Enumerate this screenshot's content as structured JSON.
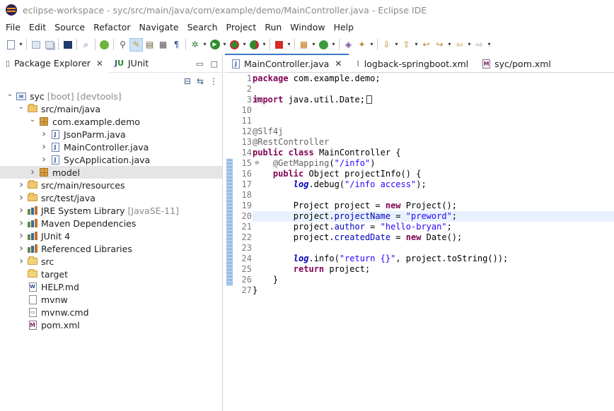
{
  "window": {
    "title": "eclipse-workspace - syc/src/main/java/com/example/demo/MainController.java - Eclipse IDE"
  },
  "menu": [
    "File",
    "Edit",
    "Source",
    "Refactor",
    "Navigate",
    "Search",
    "Project",
    "Run",
    "Window",
    "Help"
  ],
  "toolbar": {
    "icons": [
      "new-icon",
      "save-icon",
      "save-all-icon",
      "terminal-icon",
      "search-task-icon",
      "spring-boot-icon",
      "open-type-icon",
      "mark-occurrences-icon",
      "open-task-icon",
      "annotations-icon",
      "show-whitespace-icon",
      "debug-icon",
      "run-icon",
      "coverage-icon",
      "external-tools-icon",
      "stop-icon",
      "new-java-package-icon",
      "new-class-icon",
      "open-perspective-icon",
      "next-annotation-icon",
      "prev-annotation-icon",
      "last-edit-icon",
      "back-icon",
      "forward-icon"
    ]
  },
  "left_panel": {
    "tabs": [
      {
        "label": "Package Explorer",
        "active": true,
        "closable": true
      },
      {
        "label": "JUnit",
        "active": false,
        "closable": false
      }
    ],
    "tree": [
      {
        "label": "syc",
        "decoration": "[boot] [devtools]",
        "level": 0,
        "expanded": true,
        "icon": "project-icon"
      },
      {
        "label": "src/main/java",
        "level": 1,
        "expanded": true,
        "icon": "source-folder-icon"
      },
      {
        "label": "com.example.demo",
        "level": 2,
        "expanded": true,
        "icon": "package-icon"
      },
      {
        "label": "JsonParm.java",
        "level": 3,
        "expanded": false,
        "icon": "java-file-icon"
      },
      {
        "label": "MainController.java",
        "level": 3,
        "expanded": false,
        "icon": "java-file-icon"
      },
      {
        "label": "SycApplication.java",
        "level": 3,
        "expanded": false,
        "icon": "java-file-icon"
      },
      {
        "label": "model",
        "level": 2,
        "expanded": false,
        "icon": "package-icon",
        "selected": true
      },
      {
        "label": "src/main/resources",
        "level": 1,
        "expanded": false,
        "icon": "source-folder-icon"
      },
      {
        "label": "src/test/java",
        "level": 1,
        "expanded": false,
        "icon": "source-folder-icon"
      },
      {
        "label": "JRE System Library",
        "decoration": "[JavaSE-11]",
        "level": 1,
        "expanded": false,
        "icon": "library-icon"
      },
      {
        "label": "Maven Dependencies",
        "level": 1,
        "expanded": false,
        "icon": "library-icon"
      },
      {
        "label": "JUnit 4",
        "level": 1,
        "expanded": false,
        "icon": "library-icon"
      },
      {
        "label": "Referenced Libraries",
        "level": 1,
        "expanded": false,
        "icon": "library-icon"
      },
      {
        "label": "src",
        "level": 1,
        "expanded": false,
        "icon": "folder-icon"
      },
      {
        "label": "target",
        "level": 1,
        "expanded": null,
        "icon": "folder-icon"
      },
      {
        "label": "HELP.md",
        "level": 1,
        "expanded": null,
        "icon": "markdown-file-icon"
      },
      {
        "label": "mvnw",
        "level": 1,
        "expanded": null,
        "icon": "file-icon"
      },
      {
        "label": "mvnw.cmd",
        "level": 1,
        "expanded": null,
        "icon": "cmd-file-icon"
      },
      {
        "label": "pom.xml",
        "level": 1,
        "expanded": null,
        "icon": "maven-file-icon"
      }
    ]
  },
  "editor": {
    "tabs": [
      {
        "label": "MainController.java",
        "active": true,
        "closable": true,
        "icon": "java-file-icon"
      },
      {
        "label": "logback-springboot.xml",
        "active": false,
        "closable": false,
        "icon": "xml-file-icon"
      },
      {
        "label": "syc/pom.xml",
        "active": false,
        "closable": false,
        "icon": "maven-file-icon"
      }
    ],
    "current_line": 20,
    "lines": [
      {
        "n": "1",
        "tokens": [
          {
            "t": "package",
            "c": "kw"
          },
          {
            "t": " com.example.demo;"
          }
        ]
      },
      {
        "n": "2",
        "tokens": []
      },
      {
        "n": "3",
        "fold": "⊕",
        "tokens": [
          {
            "t": "import",
            "c": "kw"
          },
          {
            "t": " java.util.Date;"
          },
          {
            "t": "",
            "c": "mark"
          }
        ]
      },
      {
        "n": "10",
        "tokens": []
      },
      {
        "n": "11",
        "tokens": []
      },
      {
        "n": "12",
        "tokens": [
          {
            "t": "@Slf4j",
            "c": "ann"
          }
        ]
      },
      {
        "n": "13",
        "tokens": [
          {
            "t": "@RestController",
            "c": "ann"
          }
        ]
      },
      {
        "n": "14",
        "tokens": [
          {
            "t": "public",
            "c": "kw"
          },
          {
            "t": " "
          },
          {
            "t": "class",
            "c": "kw"
          },
          {
            "t": " MainController {"
          }
        ]
      },
      {
        "n": "15",
        "fold": "⊖",
        "tokens": [
          {
            "t": "    "
          },
          {
            "t": "@GetMapping",
            "c": "ann"
          },
          {
            "t": "("
          },
          {
            "t": "\"/info\"",
            "c": "str"
          },
          {
            "t": ")"
          }
        ]
      },
      {
        "n": "16",
        "tokens": [
          {
            "t": "    "
          },
          {
            "t": "public",
            "c": "kw"
          },
          {
            "t": " Object projectInfo() {"
          }
        ]
      },
      {
        "n": "17",
        "tokens": [
          {
            "t": "        "
          },
          {
            "t": "log",
            "c": "sfld"
          },
          {
            "t": ".debug("
          },
          {
            "t": "\"/info access\"",
            "c": "str"
          },
          {
            "t": ");"
          }
        ]
      },
      {
        "n": "18",
        "tokens": []
      },
      {
        "n": "19",
        "tokens": [
          {
            "t": "        Project project = "
          },
          {
            "t": "new",
            "c": "kw"
          },
          {
            "t": " Project();"
          }
        ]
      },
      {
        "n": "20",
        "tokens": [
          {
            "t": "        project."
          },
          {
            "t": "projectName",
            "c": "fld"
          },
          {
            "t": " = "
          },
          {
            "t": "\"preword\"",
            "c": "str"
          },
          {
            "t": ";"
          }
        ]
      },
      {
        "n": "21",
        "tokens": [
          {
            "t": "        project."
          },
          {
            "t": "author",
            "c": "fld"
          },
          {
            "t": " = "
          },
          {
            "t": "\"hello-bryan\"",
            "c": "str"
          },
          {
            "t": ";"
          }
        ]
      },
      {
        "n": "22",
        "tokens": [
          {
            "t": "        project."
          },
          {
            "t": "createdDate",
            "c": "fld"
          },
          {
            "t": " = "
          },
          {
            "t": "new",
            "c": "kw"
          },
          {
            "t": " Date();"
          }
        ]
      },
      {
        "n": "23",
        "tokens": []
      },
      {
        "n": "24",
        "tokens": [
          {
            "t": "        "
          },
          {
            "t": "log",
            "c": "sfld"
          },
          {
            "t": ".info("
          },
          {
            "t": "\"return {}\"",
            "c": "str"
          },
          {
            "t": ", project.toString());"
          }
        ]
      },
      {
        "n": "25",
        "tokens": [
          {
            "t": "        "
          },
          {
            "t": "return",
            "c": "kw"
          },
          {
            "t": " project;"
          }
        ]
      },
      {
        "n": "26",
        "tokens": [
          {
            "t": "    }"
          }
        ]
      },
      {
        "n": "27",
        "tokens": [
          {
            "t": "}"
          }
        ]
      }
    ]
  },
  "colors": {
    "keyword": "#7f0055",
    "string": "#2a00ff",
    "annotation": "#646464",
    "field": "#0000c0",
    "current_line": "#e8f2fe",
    "active_tab_accent": "#3b78c4"
  }
}
